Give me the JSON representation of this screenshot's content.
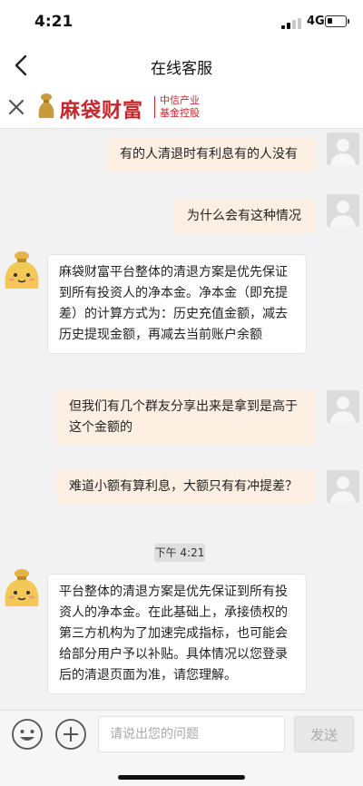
{
  "status": {
    "time": "4:21",
    "network": "4G"
  },
  "header": {
    "title": "在线客服"
  },
  "brand": {
    "name": "麻袋财富",
    "sub_line1": "中信产业",
    "sub_line2": "基金控股",
    "color": "#c3282e"
  },
  "messages": [
    {
      "role": "user",
      "text": "有的人清退时有利息有的人没有"
    },
    {
      "role": "user",
      "text": "为什么会有这种情况"
    },
    {
      "role": "agent",
      "text": "麻袋财富平台整体的清退方案是优先保证到所有投资人的净本金。净本金（即充提差）的计算方式为：历史充值金额，减去历史提现金额，再减去当前账户余额"
    },
    {
      "role": "user",
      "text": "但我们有几个群友分享出来是拿到是高于这个金额的"
    },
    {
      "role": "user",
      "text": "难道小额有算利息，大额只有有冲提差？"
    },
    {
      "role": "agent",
      "text": "平台整体的清退方案是优先保证到所有投资人的净本金。在此基础上，承接债权的第三方机构为了加速完成指标，也可能会给部分用户予以补贴。具体情况以您登录后的清退页面为准，请您理解。"
    }
  ],
  "timestamp": "下午 4:21",
  "input": {
    "placeholder": "请说出您的问题",
    "send_label": "发送"
  },
  "colors": {
    "user_bubble": "#fdf0e2",
    "agent_bubble": "#ffffff",
    "background": "#f2f2f2"
  }
}
